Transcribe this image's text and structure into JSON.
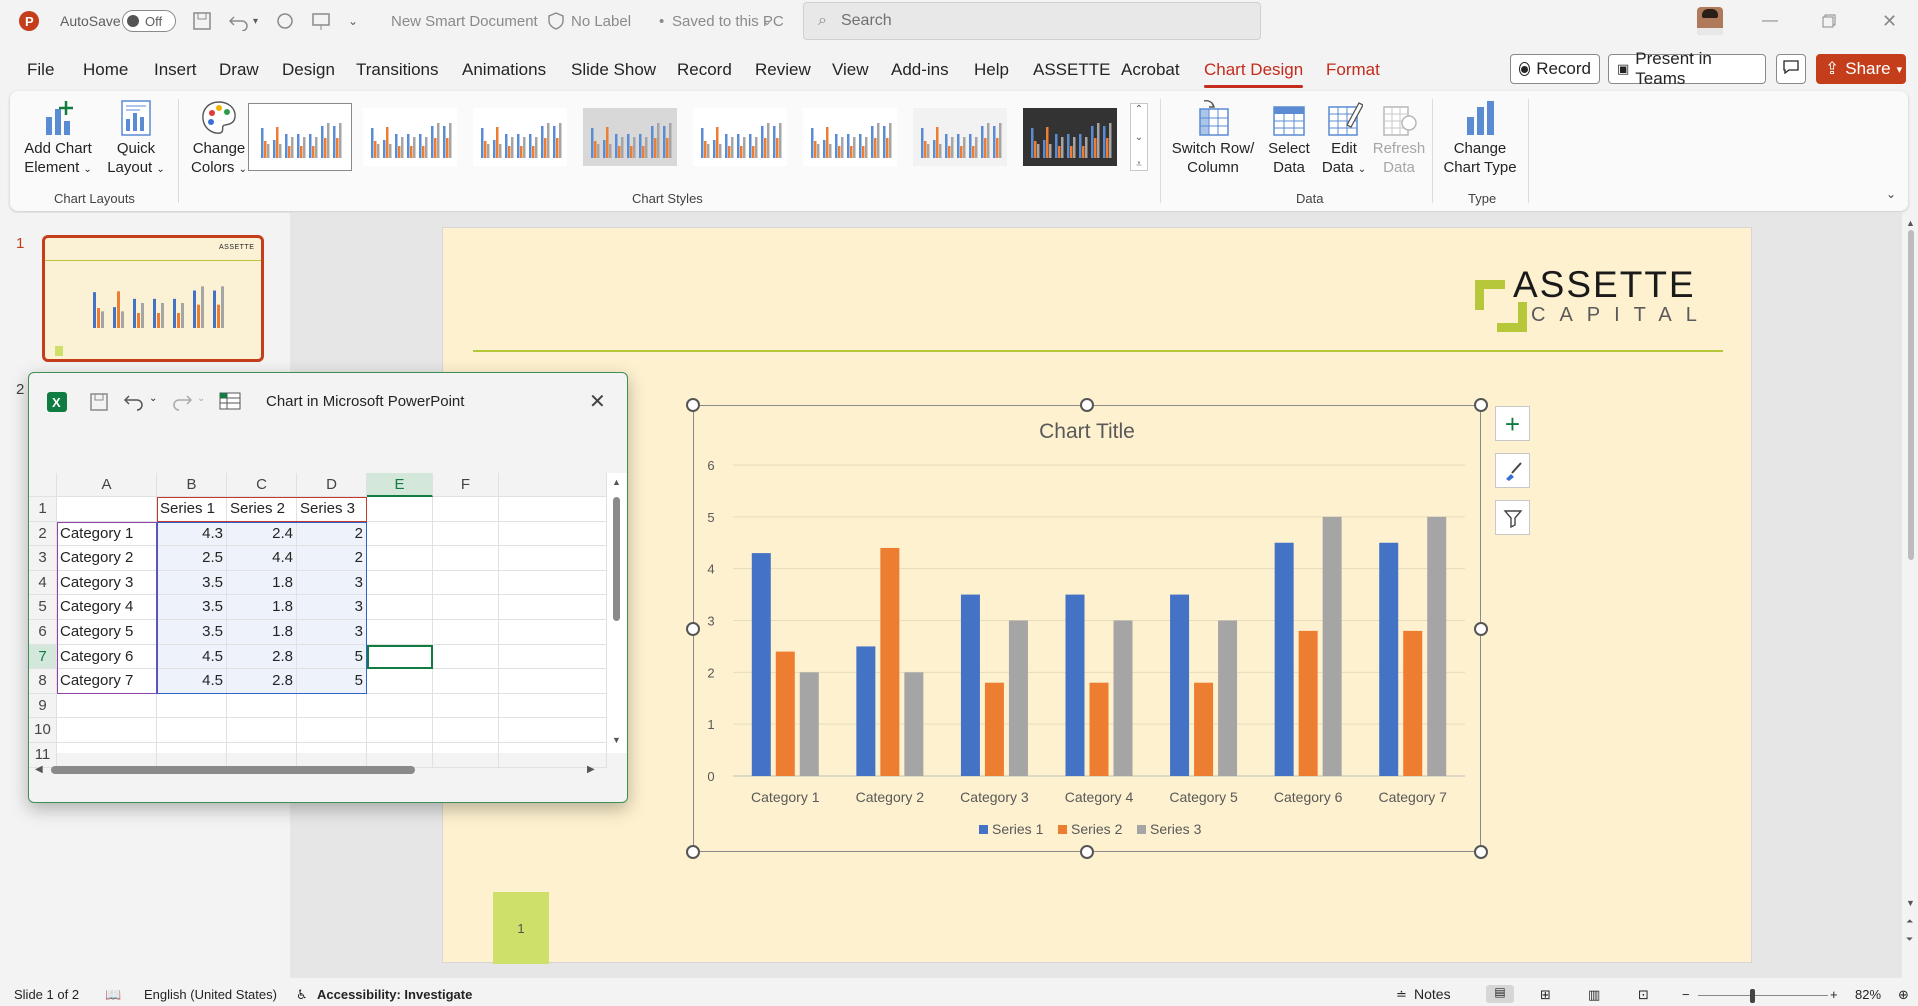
{
  "titlebar": {
    "autosave_label": "AutoSave",
    "autosave_state": "Off",
    "doc_title": "New Smart Document",
    "label_status": "No Label",
    "save_status": "Saved to this PC",
    "search_placeholder": "Search"
  },
  "tabs": [
    "File",
    "Home",
    "Insert",
    "Draw",
    "Design",
    "Transitions",
    "Animations",
    "Slide Show",
    "Record",
    "Review",
    "View",
    "Add-ins",
    "Help",
    "ASSETTE",
    "Acrobat",
    "Chart Design",
    "Format"
  ],
  "active_tab": "Chart Design",
  "right_buttons": {
    "record": "Record",
    "present": "Present in Teams",
    "share": "Share"
  },
  "ribbon": {
    "add_chart_element": [
      "Add Chart",
      "Element"
    ],
    "quick_layout": [
      "Quick",
      "Layout"
    ],
    "change_colors": [
      "Change",
      "Colors"
    ],
    "switch_row_col": [
      "Switch Row/",
      "Column"
    ],
    "select_data": [
      "Select",
      "Data"
    ],
    "edit_data": [
      "Edit",
      "Data"
    ],
    "refresh_data": [
      "Refresh",
      "Data"
    ],
    "change_chart_type": [
      "Change",
      "Chart Type"
    ],
    "groups": {
      "layouts": "Chart Layouts",
      "styles": "Chart Styles",
      "data": "Data",
      "type": "Type"
    }
  },
  "slides_panel": {
    "slide1_number": "1",
    "slide2_number": "2"
  },
  "slide": {
    "logo_top": "ASSETTE",
    "logo_bottom": "CAPITAL",
    "page_number": "1"
  },
  "colors": {
    "series1": "#4472c4",
    "series2": "#ed7d31",
    "series3": "#a5a5a5",
    "accent": "#c42b1c",
    "excel_green": "#107c41"
  },
  "chart_data": {
    "type": "bar",
    "title": "Chart Title",
    "categories": [
      "Category 1",
      "Category 2",
      "Category 3",
      "Category 4",
      "Category 5",
      "Category 6",
      "Category 7"
    ],
    "series": [
      {
        "name": "Series 1",
        "values": [
          4.3,
          2.5,
          3.5,
          3.5,
          3.5,
          4.5,
          4.5
        ]
      },
      {
        "name": "Series 2",
        "values": [
          2.4,
          4.4,
          1.8,
          1.8,
          1.8,
          2.8,
          2.8
        ]
      },
      {
        "name": "Series 3",
        "values": [
          2,
          2,
          3,
          3,
          3,
          5,
          5
        ]
      }
    ],
    "ylim": [
      0,
      6
    ],
    "yticks": [
      "0",
      "1",
      "2",
      "3",
      "4",
      "5",
      "6"
    ],
    "grid": true,
    "legend": "bottom"
  },
  "excel": {
    "window_title": "Chart in Microsoft PowerPoint",
    "columns": [
      "A",
      "B",
      "C",
      "D",
      "E",
      "F"
    ],
    "rows": [
      "1",
      "2",
      "3",
      "4",
      "5",
      "6",
      "7",
      "8",
      "9",
      "10",
      "11"
    ],
    "header_row": [
      "",
      "Series 1",
      "Series 2",
      "Series 3"
    ],
    "data_rows": [
      [
        "Category 1",
        "4.3",
        "2.4",
        "2"
      ],
      [
        "Category 2",
        "2.5",
        "4.4",
        "2"
      ],
      [
        "Category 3",
        "3.5",
        "1.8",
        "3"
      ],
      [
        "Category 4",
        "3.5",
        "1.8",
        "3"
      ],
      [
        "Category 5",
        "3.5",
        "1.8",
        "3"
      ],
      [
        "Category 6",
        "4.5",
        "2.8",
        "5"
      ],
      [
        "Category 7",
        "4.5",
        "2.8",
        "5"
      ]
    ]
  },
  "status": {
    "slide_info": "Slide 1 of 2",
    "language": "English (United States)",
    "accessibility": "Accessibility: Investigate",
    "notes": "Notes",
    "zoom": "82%"
  }
}
